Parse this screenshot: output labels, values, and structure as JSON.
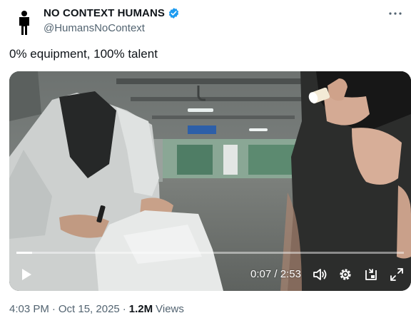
{
  "author": {
    "display_name": "NO CONTEXT HUMANS",
    "handle": "@HumansNoContext",
    "verified": true
  },
  "tweet": {
    "text": "0% equipment, 100% talent"
  },
  "video": {
    "current_time": "0:07",
    "time_separator": "/",
    "duration": "2:53",
    "progress": 0.04
  },
  "meta": {
    "time": "4:03 PM",
    "dot1": "·",
    "date": "Oct 15, 2025",
    "dot2": "·",
    "views_count": "1.2M",
    "views_label": "Views"
  },
  "colors": {
    "text_primary": "#0f1419",
    "text_secondary": "#536471",
    "verified_blue": "#1d9bf0"
  },
  "icons": {
    "avatar": "human-silhouette-icon",
    "verified": "verified-badge-icon",
    "more": "more-dots-icon",
    "play": "play-icon",
    "volume": "volume-icon",
    "settings": "gear-icon",
    "dock": "dock-icon",
    "fullscreen": "fullscreen-icon"
  }
}
